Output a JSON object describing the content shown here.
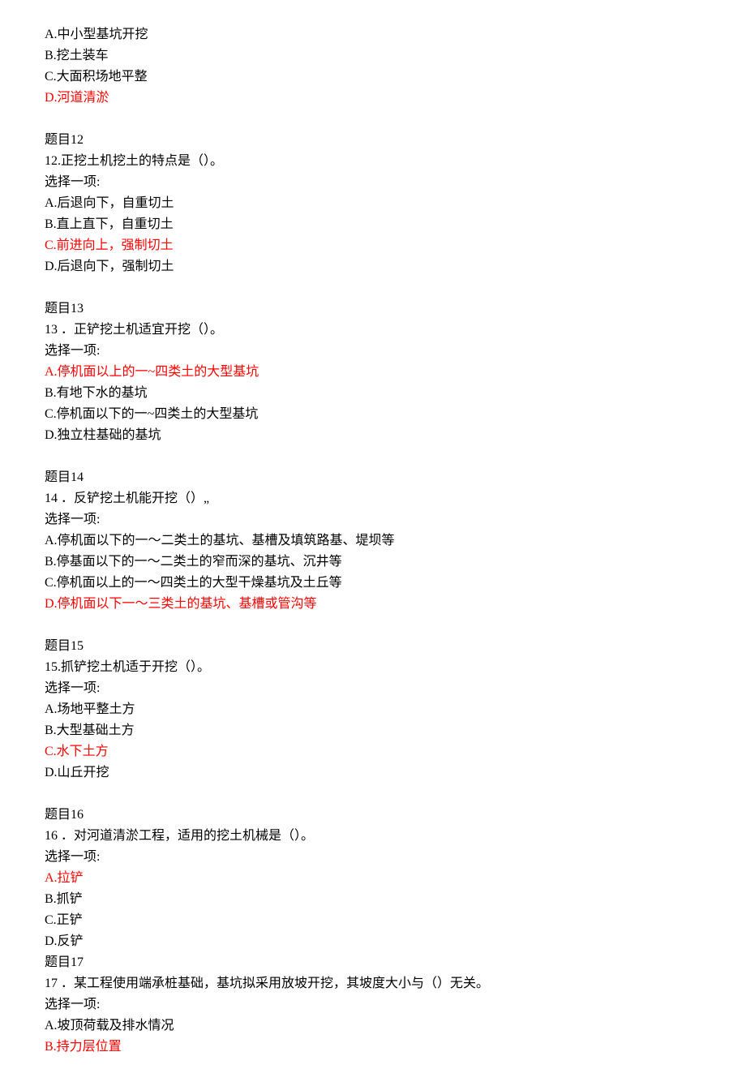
{
  "q11_tail": {
    "optA": "A.中小型基坑开挖",
    "optB": "B.挖土装车",
    "optC": "C.大面积场地平整",
    "optD": "D.河道清淤"
  },
  "q12": {
    "title": "题目12",
    "stem": "12.正挖土机挖土的特点是（）。",
    "prompt": "选择一项:",
    "optA": "A.后退向下，自重切土",
    "optB": "B.直上直下，自重切土",
    "optC": "C.前进向上，强制切土",
    "optD": "D.后退向下，强制切土"
  },
  "q13": {
    "title": "题目13",
    "stem": "13 ．正铲挖土机适宜开挖（）。",
    "prompt": "选择一项:",
    "optA": "A.停机面以上的一~四类土的大型基坑",
    "optB": "B.有地下水的基坑",
    "optC": "C.停机面以下的一~四类土的大型基坑",
    "optD": "D.独立柱基础的基坑"
  },
  "q14": {
    "title": "题目14",
    "stem": "14 ．反铲挖土机能开挖（）„",
    "prompt": "选择一项:",
    "optA": "A.停机面以下的一～二类土的基坑、基槽及填筑路基、堤坝等",
    "optB": "B.停基面以下的一～二类土的窄而深的基坑、沉井等",
    "optC": "C.停机面以上的一～四类土的大型干燥基坑及土丘等",
    "optD": "D.停机面以下一～三类土的基坑、基槽或管沟等"
  },
  "q15": {
    "title": "题目15",
    "stem": "15.抓铲挖土机适于开挖（）。",
    "prompt": "选择一项:",
    "optA": "A.场地平整土方",
    "optB": "B.大型基础土方",
    "optC": "C.水下土方",
    "optD": "D.山丘开挖"
  },
  "q16": {
    "title": "题目16",
    "stem": "16 ．对河道清淤工程，适用的挖土机械是（）。",
    "prompt": "选择一项:",
    "optA": "A.拉铲",
    "optB": "B.抓铲",
    "optC": "C.正铲",
    "optD": "D.反铲"
  },
  "q17": {
    "title": "题目17",
    "stem": "17 ．某工程使用端承桩基础，基坑拟采用放坡开挖，其坡度大小与（）无关。",
    "prompt": "选择一项:",
    "optA": "A.坡顶荷载及排水情况",
    "optB": "B.持力层位置"
  }
}
